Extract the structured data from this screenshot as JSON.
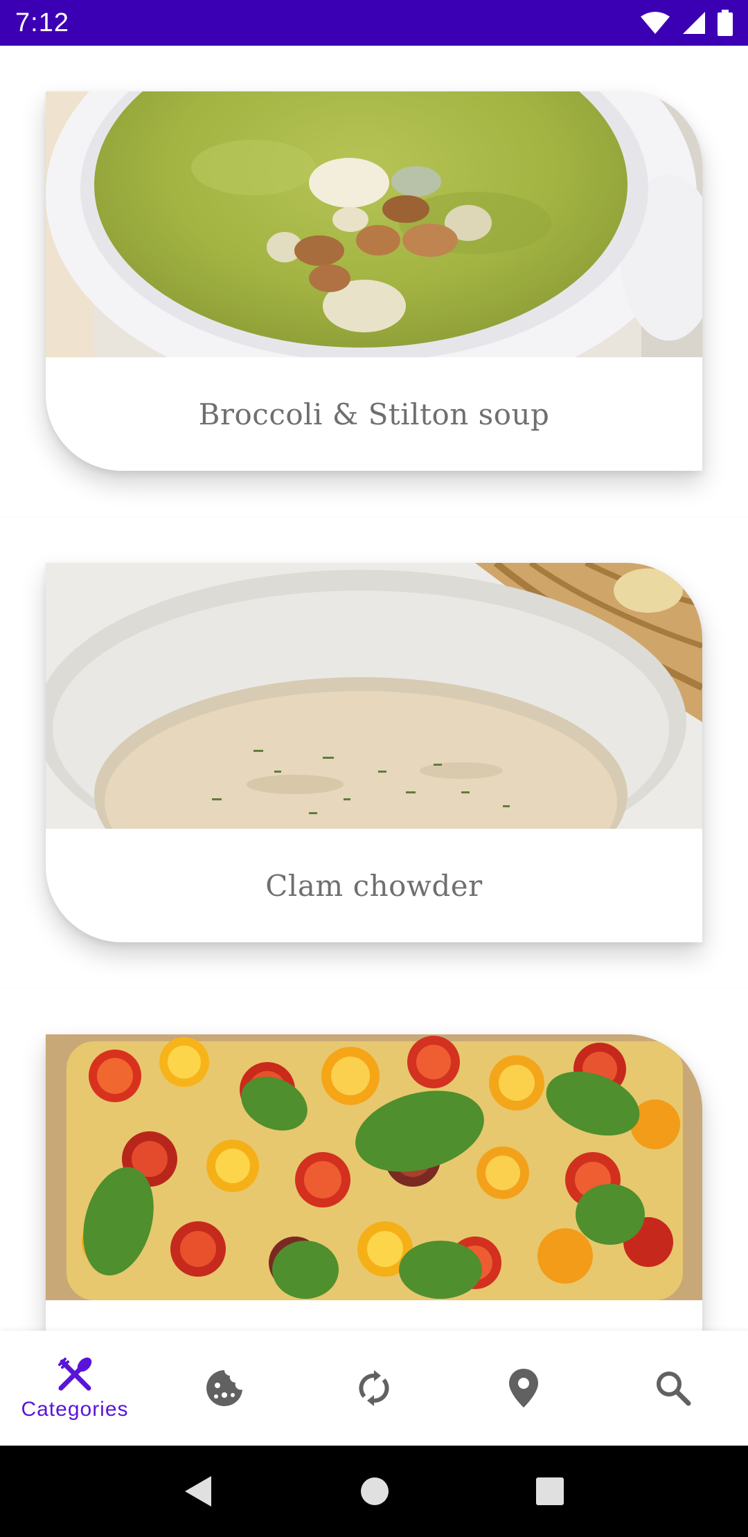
{
  "status_bar": {
    "time": "7:12",
    "background": "#3c00b4",
    "icons": [
      "wifi-icon",
      "signal-icon",
      "battery-icon"
    ]
  },
  "recipes": [
    {
      "title": "Broccoli & Stilton soup"
    },
    {
      "title": "Clam chowder"
    },
    {
      "title": ""
    }
  ],
  "bottom_nav": {
    "accent_color": "#5a14d8",
    "items": [
      {
        "icon": "cutlery-icon",
        "label": "Categories",
        "selected": true
      },
      {
        "icon": "cookie-icon",
        "selected": false
      },
      {
        "icon": "refresh-icon",
        "selected": false
      },
      {
        "icon": "location-pin-icon",
        "selected": false
      },
      {
        "icon": "search-icon",
        "selected": false
      }
    ]
  },
  "system_nav": {
    "icons": [
      "back-icon",
      "home-icon",
      "recents-icon"
    ]
  }
}
